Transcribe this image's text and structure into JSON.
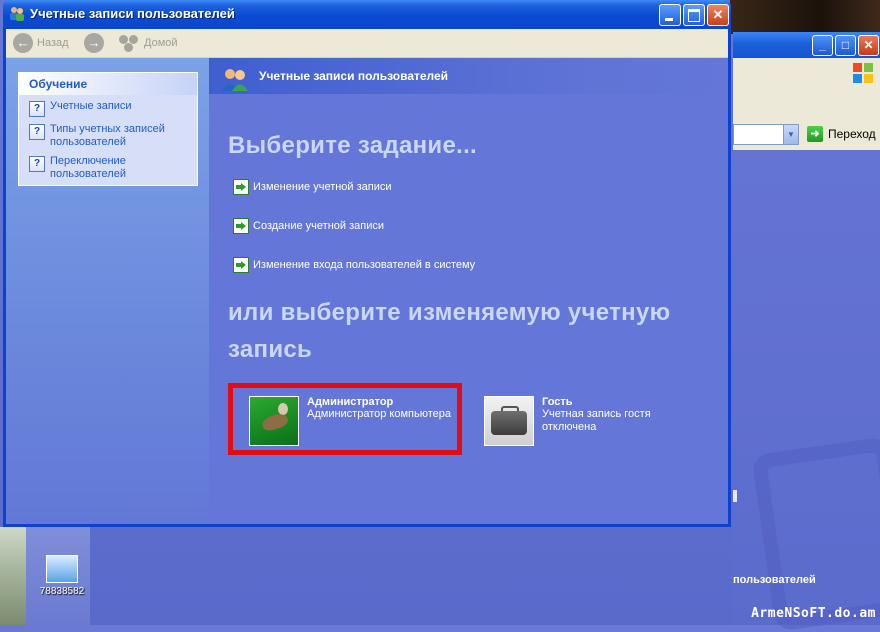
{
  "window": {
    "title": "Учетные записи пользователей",
    "minimize_label": "_",
    "maximize_label": "□",
    "close_label": "✕"
  },
  "toolbar": {
    "back_label": "Назад",
    "forward_label": "",
    "home_label": "Домой"
  },
  "sidebar": {
    "panel_title": "Обучение",
    "items": [
      {
        "label": "Учетные записи"
      },
      {
        "label": "Типы учетных записей пользователей"
      },
      {
        "label": "Переключение пользователей"
      }
    ]
  },
  "content": {
    "header_title": "Учетные записи пользователей",
    "task_heading": "Выберите задание...",
    "tasks": [
      {
        "label": "Изменение учетной записи"
      },
      {
        "label": "Создание учетной записи"
      },
      {
        "label": "Изменение входа пользователей в систему"
      }
    ],
    "account_heading_line1": "или выберите изменяемую учетную",
    "account_heading_line2": "запись",
    "accounts": [
      {
        "name": "Администратор",
        "description": "Администратор компьютера",
        "picture": "admin-skateboard-picture",
        "selected": true
      },
      {
        "name": "Гость",
        "description_line1": "Учетная запись гостя",
        "description_line2": "отключена",
        "picture": "guest-suitcase-picture"
      }
    ]
  },
  "background_window": {
    "go_label": "Переход",
    "partial_text": "пользователей"
  },
  "desktop": {
    "icon_label": "78838582",
    "watermark": "ArmeNSoFT.do.am"
  },
  "colors": {
    "title_bar": "#0b47cc",
    "content_bg": "#6477d8",
    "highlight": "#e10d12",
    "link": "#215dc6"
  }
}
